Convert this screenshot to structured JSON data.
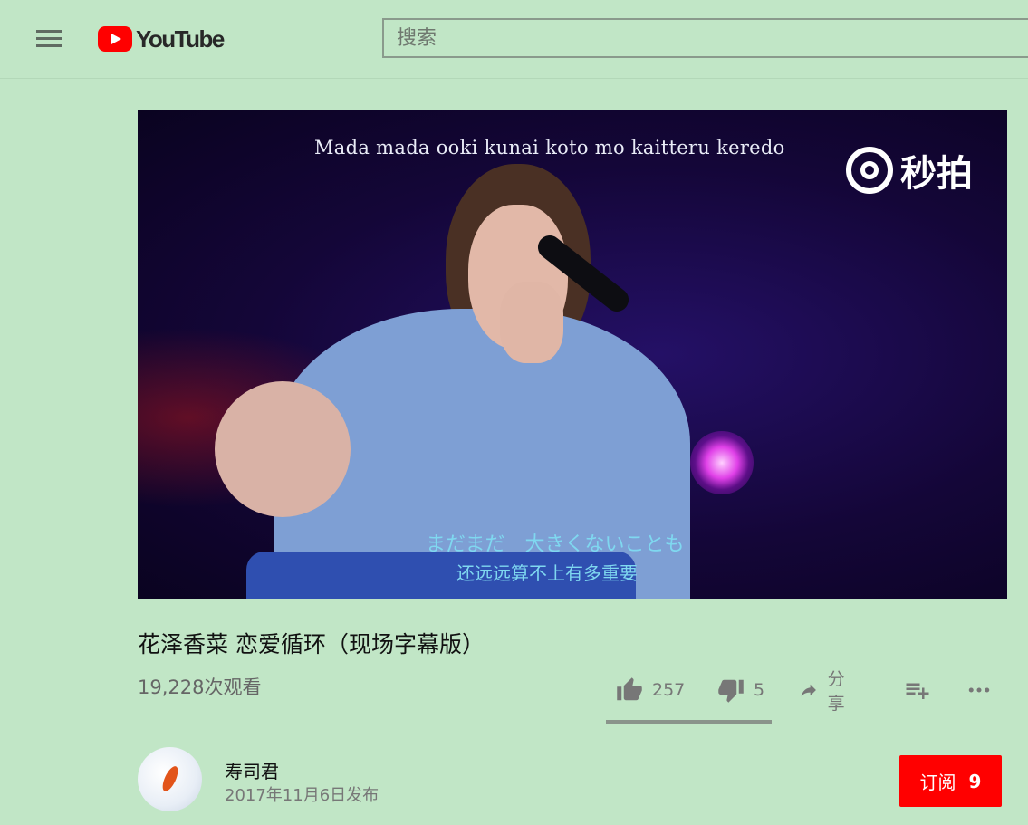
{
  "header": {
    "logo_text": "YouTube",
    "search_placeholder": "搜索"
  },
  "player": {
    "lyric_romaji": "Mada mada ooki kunai koto mo kaitteru keredo",
    "watermark": "秒拍",
    "lyric_japanese": "まだまだ　大きくないことも",
    "lyric_chinese": "还远远算不上有多重要"
  },
  "video": {
    "title": "花泽香菜 恋爱循环（现场字幕版）",
    "views": "19,228次观看"
  },
  "actions": {
    "like_count": "257",
    "dislike_count": "5",
    "share_label": "分享"
  },
  "channel": {
    "name": "寿司君",
    "published": "2017年11月6日发布",
    "subscribe_label": "订阅",
    "subscriber_count": "9"
  },
  "colors": {
    "page_background": "#c1e6c6",
    "brand_red": "#ff0000",
    "icon_gray": "#777777"
  }
}
